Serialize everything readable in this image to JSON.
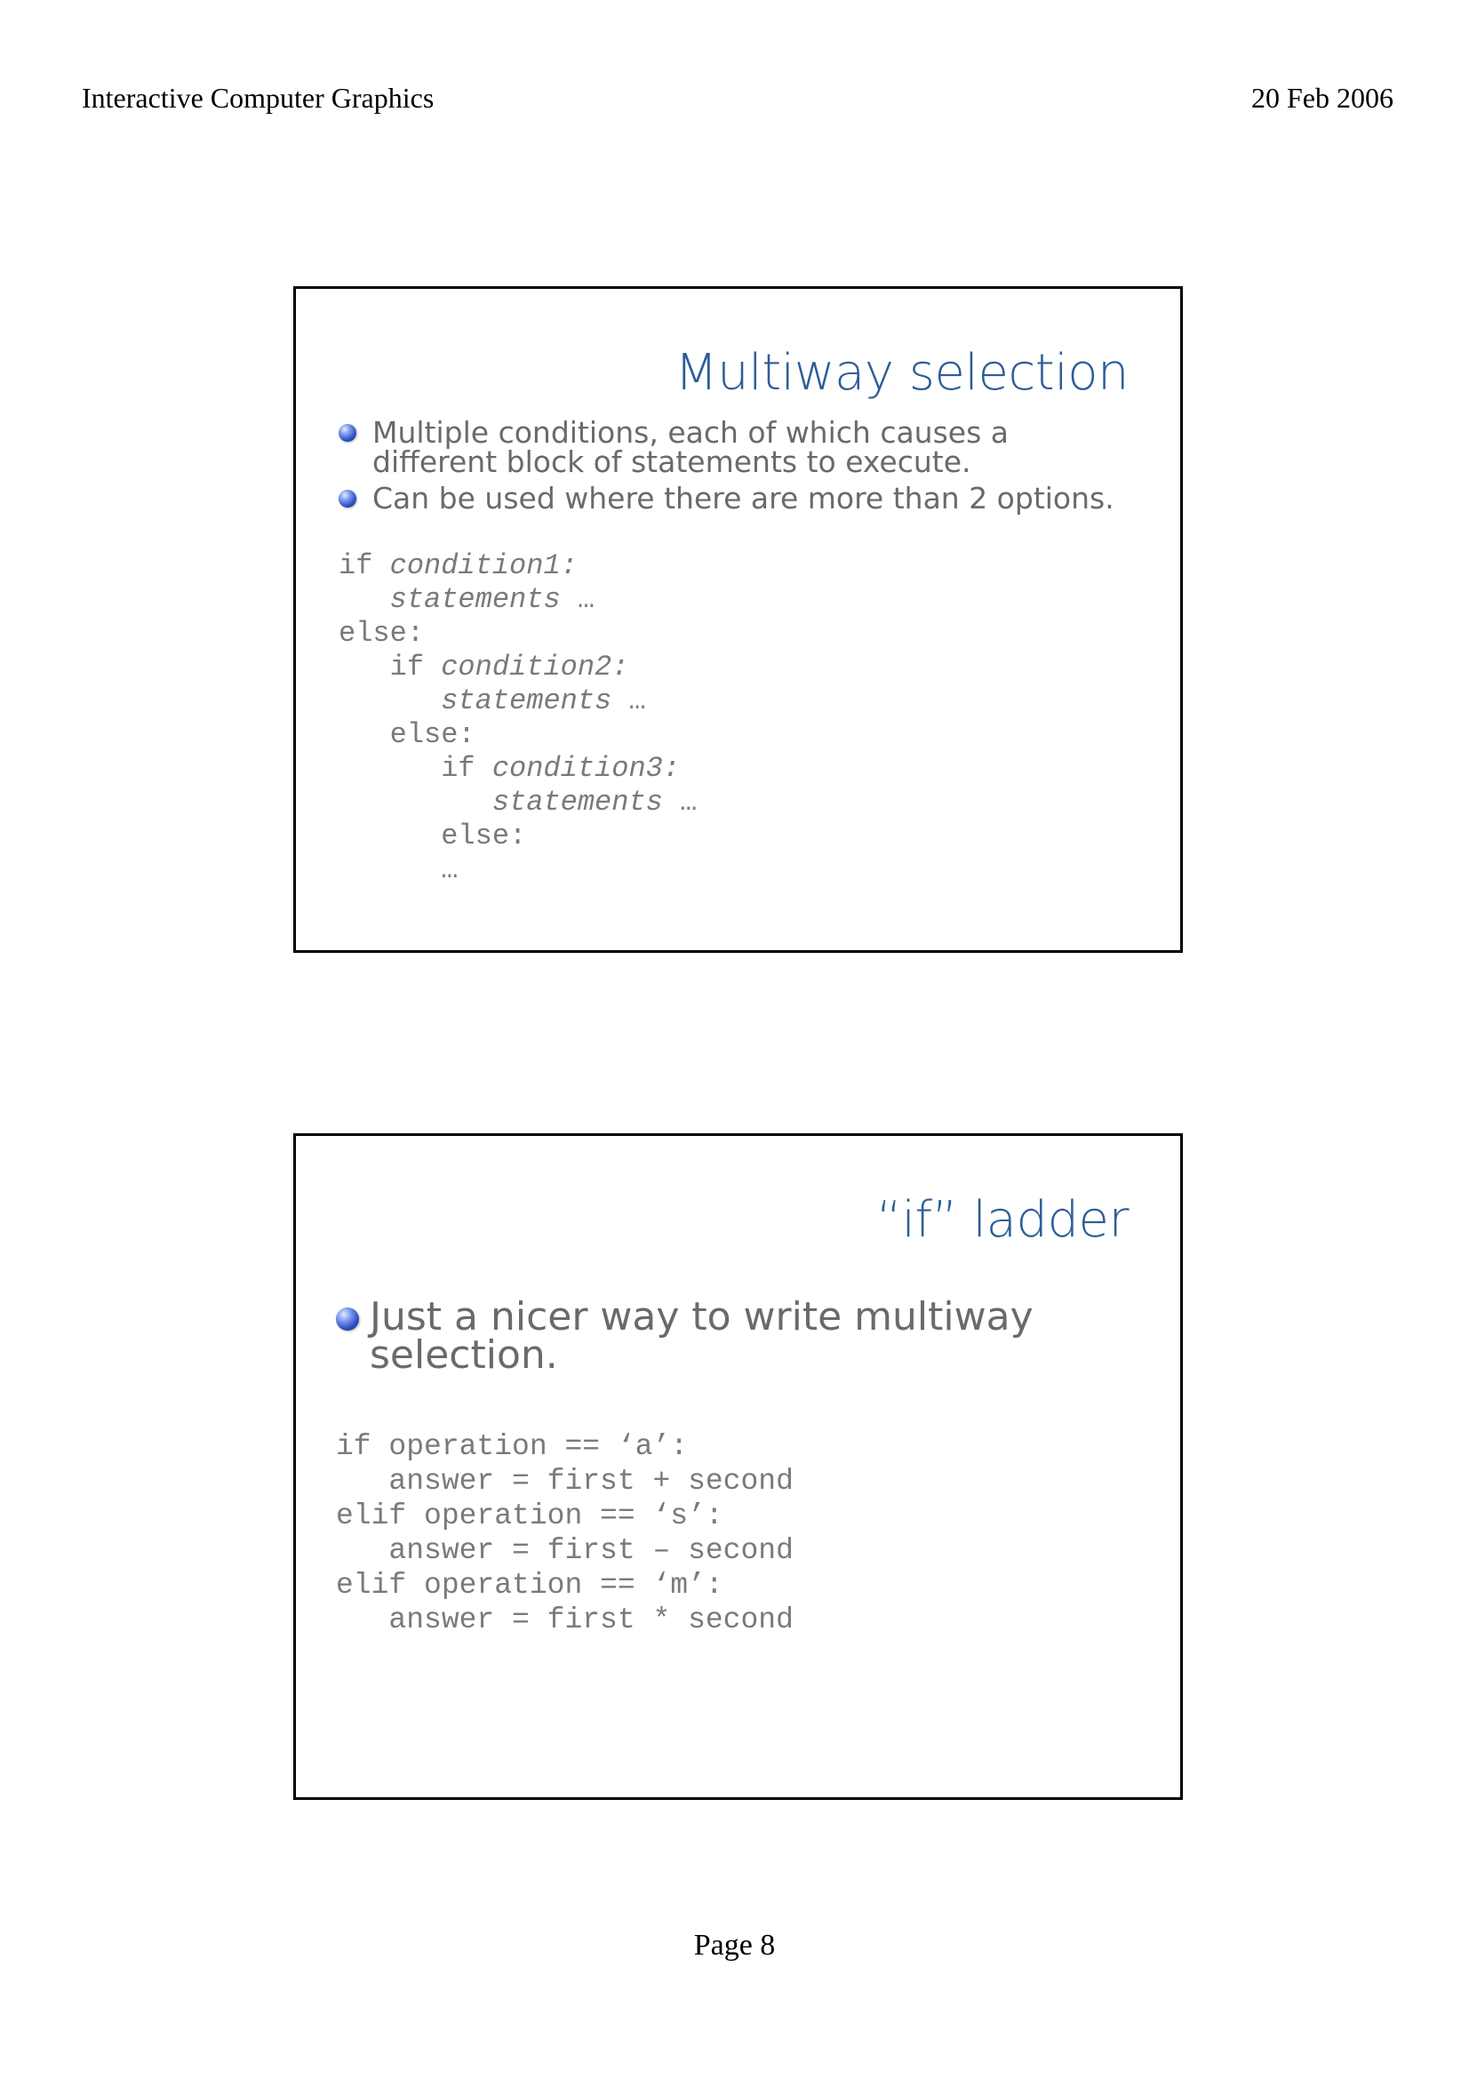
{
  "header": {
    "left": "Interactive Computer Graphics",
    "right": "20 Feb 2006"
  },
  "footer": {
    "page": "Page 8"
  },
  "slides": [
    {
      "title": "Multiway selection",
      "bullets": [
        "Multiple conditions, each of which causes a different block of statements to execute.",
        "Can be used where there are more than 2 options."
      ],
      "code": [
        {
          "indent": "",
          "kw": "if ",
          "it": "condition1:",
          "tail": ""
        },
        {
          "indent": "   ",
          "kw": "",
          "it": "statements",
          "tail": " …"
        },
        {
          "indent": "",
          "kw": "else:",
          "it": "",
          "tail": ""
        },
        {
          "indent": "   ",
          "kw": "if ",
          "it": "condition2:",
          "tail": ""
        },
        {
          "indent": "      ",
          "kw": "",
          "it": "statements",
          "tail": " …"
        },
        {
          "indent": "   ",
          "kw": "else:",
          "it": "",
          "tail": ""
        },
        {
          "indent": "      ",
          "kw": "if ",
          "it": "condition3:",
          "tail": ""
        },
        {
          "indent": "         ",
          "kw": "",
          "it": "statements",
          "tail": " …"
        },
        {
          "indent": "      ",
          "kw": "else:",
          "it": "",
          "tail": ""
        },
        {
          "indent": "      ",
          "kw": "…",
          "it": "",
          "tail": ""
        }
      ]
    },
    {
      "title": "“if” ladder",
      "bullets": [
        "Just a nicer way to write multiway selection."
      ],
      "code": [
        "if operation == ‘a’:",
        "   answer = first + second",
        "elif operation == ‘s’:",
        "   answer = first – second",
        "elif operation == ‘m’:",
        "   answer = first * second"
      ]
    }
  ]
}
